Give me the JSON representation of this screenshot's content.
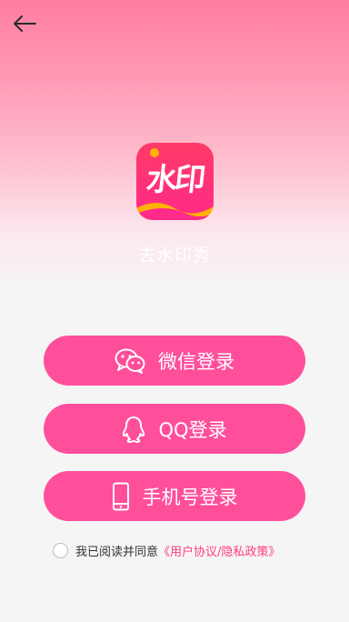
{
  "header": {
    "back_icon": "arrow-left-icon"
  },
  "app": {
    "logo_text": "水印",
    "name": "去水印秀",
    "colors": {
      "logo_top": "#ff3b6b",
      "logo_bottom": "#ff2d87",
      "logo_accent": "#ffb300"
    }
  },
  "login": {
    "wechat_label": "微信登录",
    "qq_label": "QQ登录",
    "phone_label": "手机号登录",
    "button_color": "#ff4f9b"
  },
  "agreement": {
    "prefix": "我已阅读并同意",
    "link": "《用户协议/隐私政策》",
    "checked": false
  }
}
